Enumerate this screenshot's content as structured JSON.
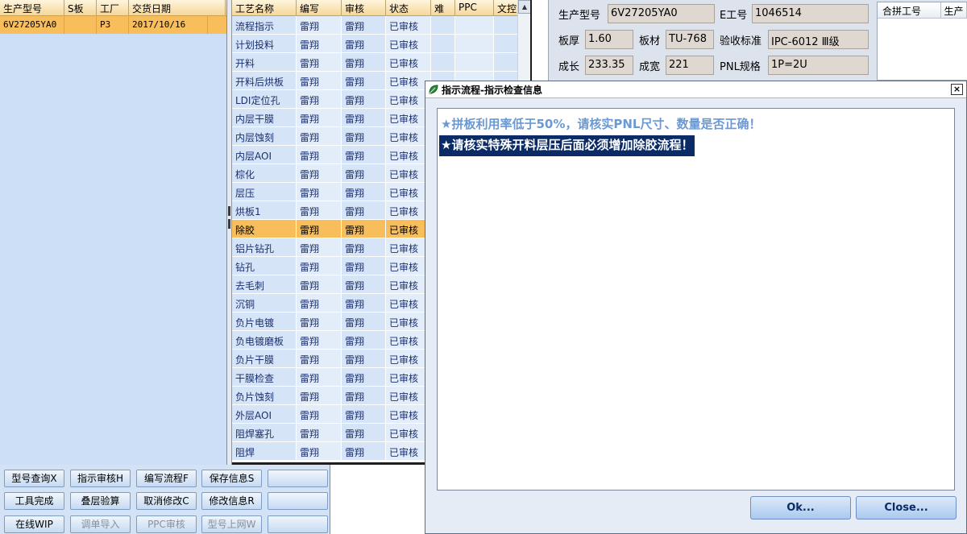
{
  "left_grid": {
    "columns": [
      "生产型号",
      "S板",
      "工厂",
      "交货日期"
    ],
    "rows": [
      {
        "model": "6V27205YA0",
        "s_board": "",
        "factory": "P3",
        "date": "2017/10/16"
      }
    ]
  },
  "process_grid": {
    "columns": [
      "工艺名称",
      "编写",
      "审核",
      "状态",
      "难",
      "PPC",
      "文控"
    ],
    "selected_index": 11,
    "rows": [
      {
        "name": "流程指示",
        "writer": "雷翔",
        "reviewer": "雷翔",
        "status": "已审核"
      },
      {
        "name": "计划投料",
        "writer": "雷翔",
        "reviewer": "雷翔",
        "status": "已审核"
      },
      {
        "name": "开料",
        "writer": "雷翔",
        "reviewer": "雷翔",
        "status": "已审核"
      },
      {
        "name": "开料后烘板",
        "writer": "雷翔",
        "reviewer": "雷翔",
        "status": "已审核"
      },
      {
        "name": "LDI定位孔",
        "writer": "雷翔",
        "reviewer": "雷翔",
        "status": "已审核"
      },
      {
        "name": "内层干膜",
        "writer": "雷翔",
        "reviewer": "雷翔",
        "status": "已审核"
      },
      {
        "name": "内层蚀刻",
        "writer": "雷翔",
        "reviewer": "雷翔",
        "status": "已审核"
      },
      {
        "name": "内层AOI",
        "writer": "雷翔",
        "reviewer": "雷翔",
        "status": "已审核"
      },
      {
        "name": "棕化",
        "writer": "雷翔",
        "reviewer": "雷翔",
        "status": "已审核"
      },
      {
        "name": "层压",
        "writer": "雷翔",
        "reviewer": "雷翔",
        "status": "已审核"
      },
      {
        "name": "烘板1",
        "writer": "雷翔",
        "reviewer": "雷翔",
        "status": "已审核"
      },
      {
        "name": "除胶",
        "writer": "雷翔",
        "reviewer": "雷翔",
        "status": "已审核"
      },
      {
        "name": "铝片钻孔",
        "writer": "雷翔",
        "reviewer": "雷翔",
        "status": "已审核"
      },
      {
        "name": "钻孔",
        "writer": "雷翔",
        "reviewer": "雷翔",
        "status": "已审核"
      },
      {
        "name": "去毛刺",
        "writer": "雷翔",
        "reviewer": "雷翔",
        "status": "已审核"
      },
      {
        "name": "沉铜",
        "writer": "雷翔",
        "reviewer": "雷翔",
        "status": "已审核"
      },
      {
        "name": "负片电镀",
        "writer": "雷翔",
        "reviewer": "雷翔",
        "status": "已审核"
      },
      {
        "name": "负电镀磨板",
        "writer": "雷翔",
        "reviewer": "雷翔",
        "status": "已审核"
      },
      {
        "name": "负片干膜",
        "writer": "雷翔",
        "reviewer": "雷翔",
        "status": "已审核"
      },
      {
        "name": "干膜检查",
        "writer": "雷翔",
        "reviewer": "雷翔",
        "status": "已审核"
      },
      {
        "name": "负片蚀刻",
        "writer": "雷翔",
        "reviewer": "雷翔",
        "status": "已审核"
      },
      {
        "name": "外层AOI",
        "writer": "雷翔",
        "reviewer": "雷翔",
        "status": "已审核"
      },
      {
        "name": "阻焊塞孔",
        "writer": "雷翔",
        "reviewer": "雷翔",
        "status": "已审核"
      },
      {
        "name": "阻焊",
        "writer": "雷翔",
        "reviewer": "雷翔",
        "status": "已审核"
      }
    ]
  },
  "detail": {
    "model_label": "生产型号",
    "model_value": "6V27205YA0",
    "e_no_label": "E工号",
    "e_no_value": "1046514",
    "thickness_label": "板厚",
    "thickness_value": "1.60",
    "material_label": "板材",
    "material_value": "TU-768",
    "standard_label": "验收标准",
    "standard_value": "IPC-6012 Ⅲ级",
    "length_label": "成长",
    "length_value": "233.35",
    "width_label": "成宽",
    "width_value": "221",
    "pnl_label": "PNL规格",
    "pnl_value": "1P=2U",
    "merge_columns": [
      "合拼工号",
      "生产"
    ]
  },
  "buttons": [
    {
      "label": "型号查询X",
      "enabled": true
    },
    {
      "label": "指示审核H",
      "enabled": true
    },
    {
      "label": "编写流程F",
      "enabled": true
    },
    {
      "label": "保存信息S",
      "enabled": true
    },
    {
      "label": "",
      "enabled": true
    },
    {
      "label": "工具完成",
      "enabled": true
    },
    {
      "label": "叠层验算",
      "enabled": true
    },
    {
      "label": "取消修改C",
      "enabled": true
    },
    {
      "label": "修改信息R",
      "enabled": true
    },
    {
      "label": "",
      "enabled": true
    },
    {
      "label": "在线WIP",
      "enabled": true
    },
    {
      "label": "调单导入",
      "enabled": false
    },
    {
      "label": "PPC审核",
      "enabled": false
    },
    {
      "label": "型号上网W",
      "enabled": false
    },
    {
      "label": "",
      "enabled": true
    }
  ],
  "dialog": {
    "title": "指示流程-指示检查信息",
    "close_glyph": "×",
    "messages": [
      {
        "text": "★拼板利用率低于50%，请核实PNL尺寸、数量是否正确！",
        "highlighted": false
      },
      {
        "text": "★请核实特殊开料层压后面必须增加除胶流程！",
        "highlighted": true
      }
    ],
    "ok_label": "Ok...",
    "close_label": "Close..."
  },
  "colors": {
    "selection": "#f8be5c",
    "grid_bg": "#ccdff7",
    "highlight_bg": "#0b2b66",
    "message_blue": "#6a99d4"
  }
}
